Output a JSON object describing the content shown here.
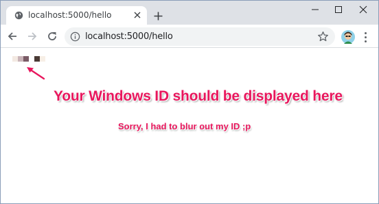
{
  "browser": {
    "tab": {
      "title": "localhost:5000/hello",
      "favicon": "globe-icon"
    },
    "url": "localhost:5000/hello",
    "icons": {
      "back": "arrow-left-icon",
      "forward": "arrow-right-icon",
      "reload": "reload-icon",
      "info": "info-icon",
      "bookmark": "star-icon",
      "profile": "avatar",
      "menu": "kebab-menu-icon"
    }
  },
  "page": {
    "annotation_main": "Your Windows ID should be displayed here",
    "annotation_sub": "Sorry, I had to blur out my ID ;p",
    "blurred_id_colors": [
      "#f3e9e2",
      "#c9b4b8",
      "#7a5b66",
      "#ffffff",
      "#4a3a35",
      "#f7efe6"
    ]
  },
  "colors": {
    "annotation": "#e8175d",
    "tabstrip": "#dee1e6",
    "omnibox": "#f1f3f4"
  }
}
